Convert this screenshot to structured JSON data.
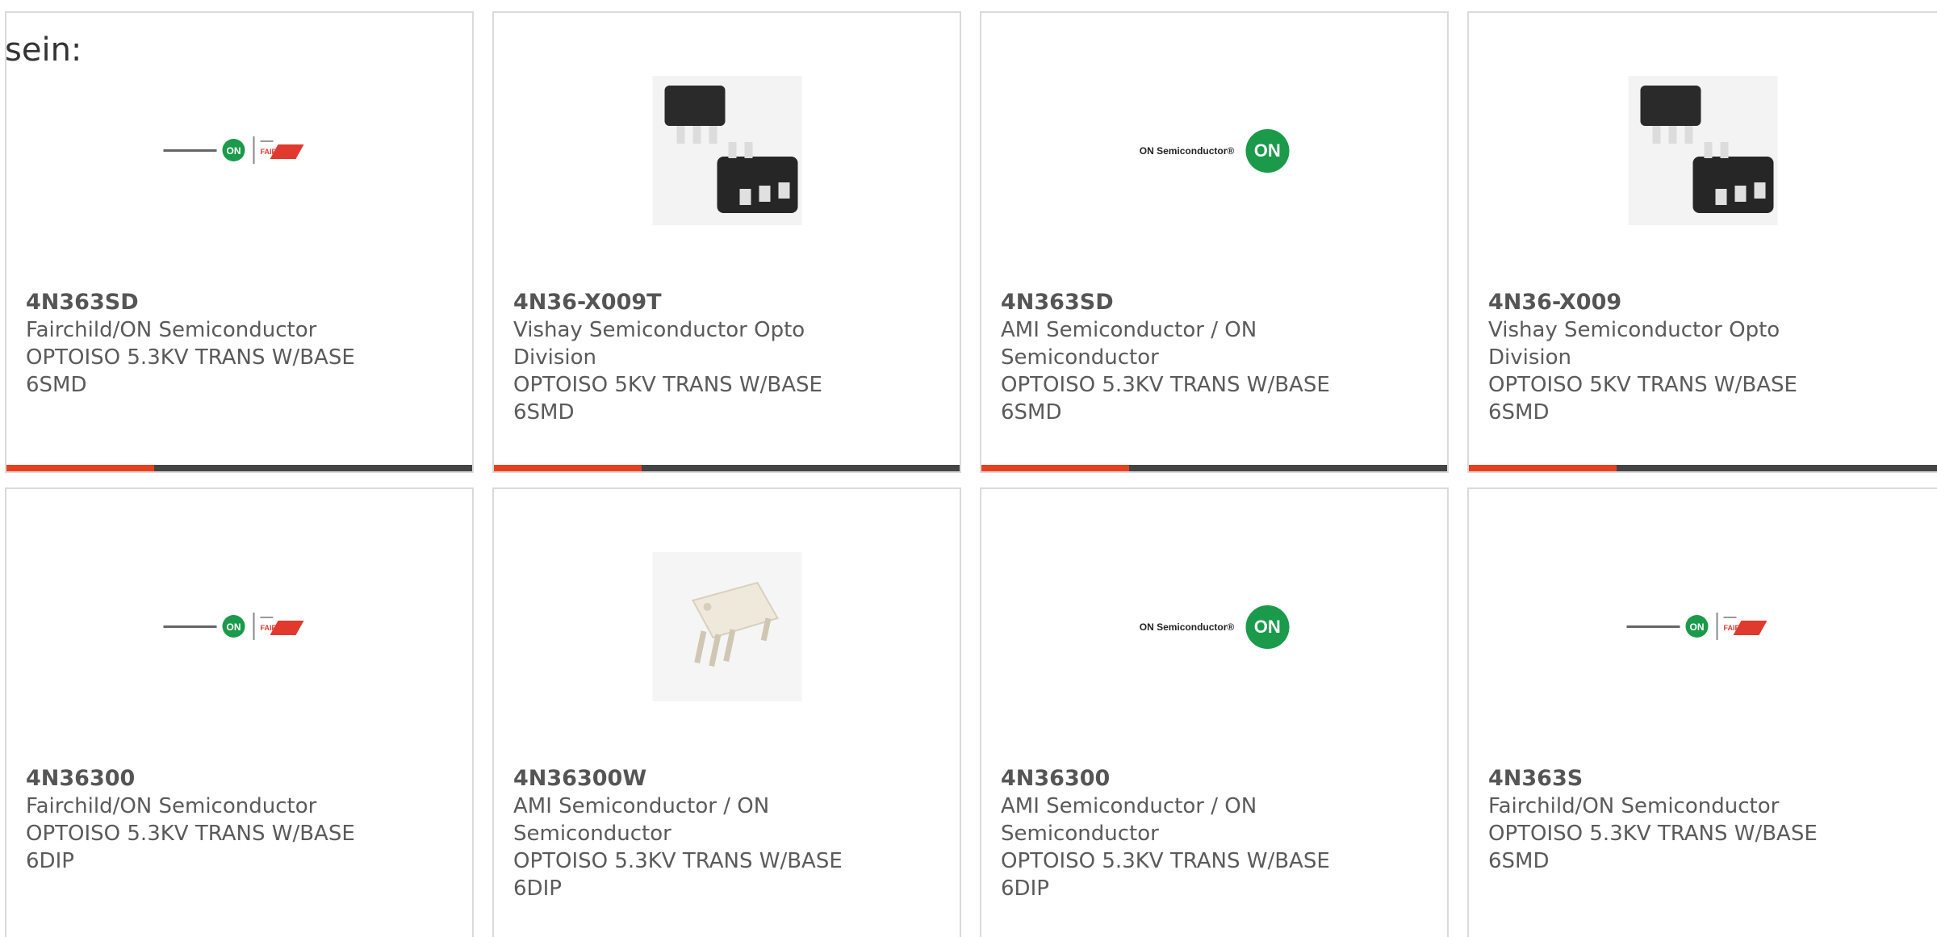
{
  "lead_text": "sein:",
  "colors": {
    "accent": "#e8401c",
    "bar": "#444444",
    "on_green": "#1a9a4a",
    "fairchild_red": "#e03a2e"
  },
  "cards": [
    {
      "part_number": "4N363SD",
      "lines": [
        "Fairchild/ON Semiconductor",
        "OPTOISO 5.3KV TRANS W/BASE",
        "6SMD"
      ],
      "image": "fairchild-on-logo"
    },
    {
      "part_number": "4N36-X009T",
      "lines": [
        "Vishay Semiconductor Opto",
        "Division",
        "OPTOISO 5KV TRANS W/BASE",
        "6SMD"
      ],
      "image": "smd-chip-image"
    },
    {
      "part_number": "4N363SD",
      "lines": [
        "AMI Semiconductor / ON",
        "Semiconductor",
        "OPTOISO 5.3KV TRANS W/BASE",
        "6SMD"
      ],
      "image": "on-semiconductor-logo",
      "logo_text": "ON Semiconductor®",
      "badge_text": "ON"
    },
    {
      "part_number": "4N36-X009",
      "lines": [
        "Vishay Semiconductor Opto",
        "Division",
        "OPTOISO 5KV TRANS W/BASE",
        "6SMD"
      ],
      "image": "smd-chip-image"
    },
    {
      "part_number": "4N36300",
      "lines": [
        "Fairchild/ON Semiconductor",
        "OPTOISO 5.3KV TRANS W/BASE",
        "6DIP"
      ],
      "image": "fairchild-on-logo"
    },
    {
      "part_number": "4N36300W",
      "lines": [
        "AMI Semiconductor / ON",
        "Semiconductor",
        "OPTOISO 5.3KV TRANS W/BASE",
        "6DIP"
      ],
      "image": "dip-chip-image"
    },
    {
      "part_number": "4N36300",
      "lines": [
        "AMI Semiconductor / ON",
        "Semiconductor",
        "OPTOISO 5.3KV TRANS W/BASE",
        "6DIP"
      ],
      "image": "on-semiconductor-logo",
      "logo_text": "ON Semiconductor®",
      "badge_text": "ON"
    },
    {
      "part_number": "4N363S",
      "lines": [
        "Fairchild/ON Semiconductor",
        "OPTOISO 5.3KV TRANS W/BASE",
        "6SMD"
      ],
      "image": "fairchild-on-logo"
    }
  ]
}
